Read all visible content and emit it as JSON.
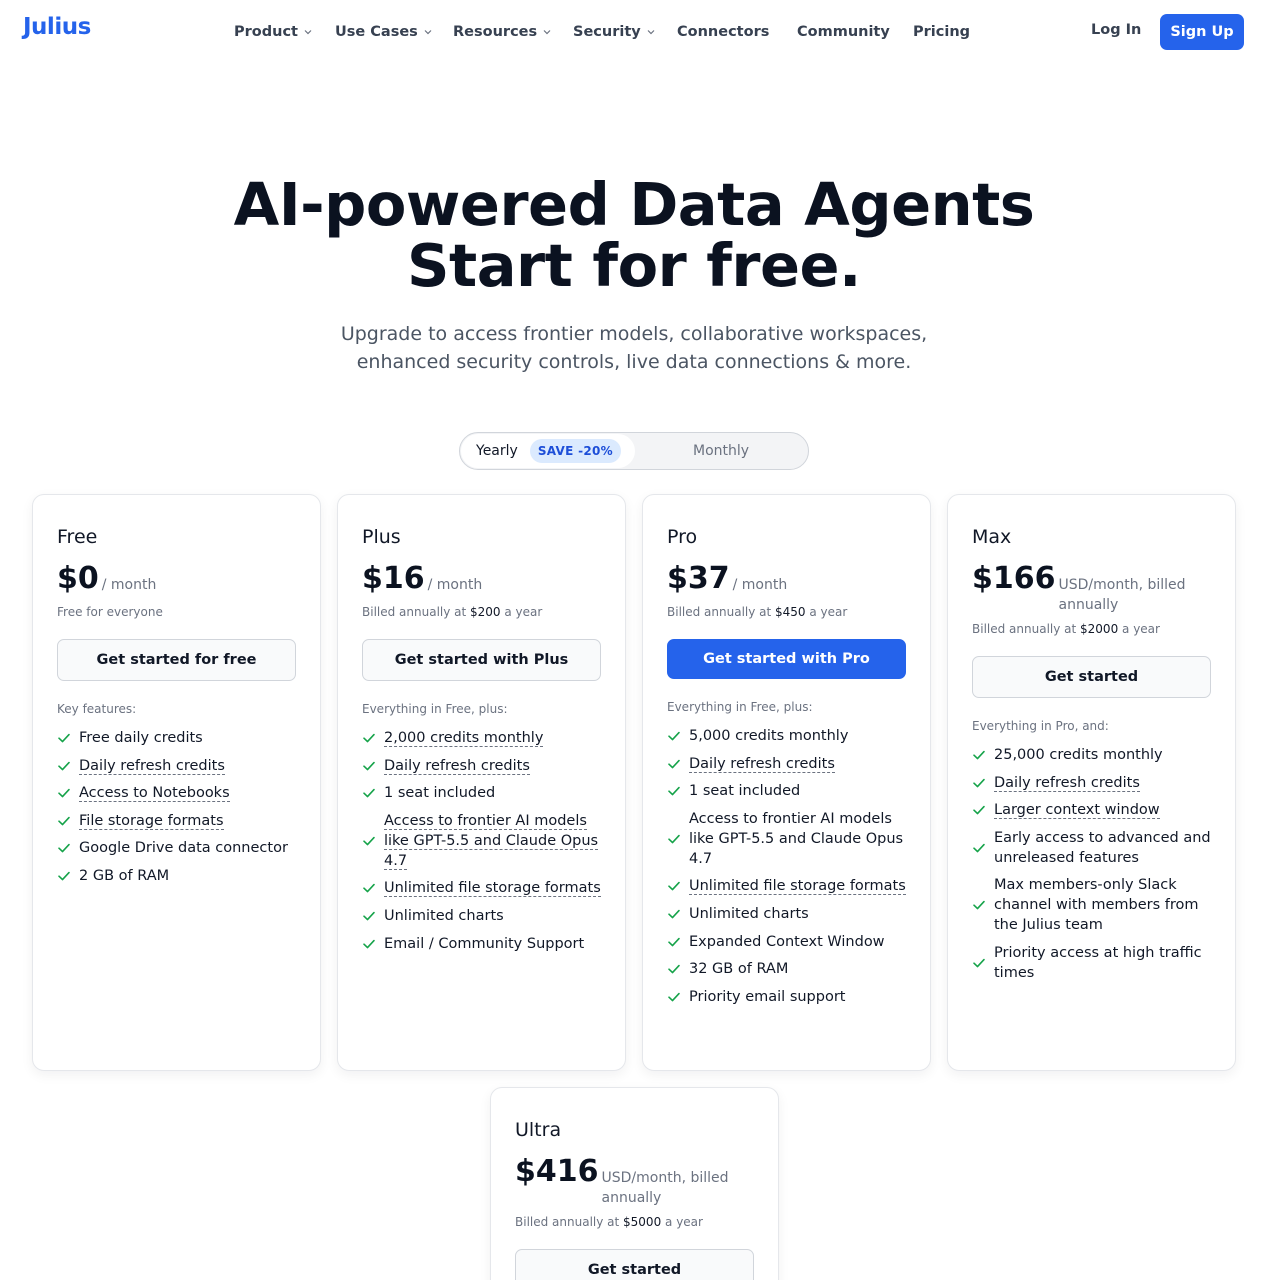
{
  "brand": {
    "logo": "Julius",
    "accent": "#2563eb"
  },
  "nav": {
    "items": [
      {
        "label": "Product",
        "dropdown": true
      },
      {
        "label": "Use Cases",
        "dropdown": true
      },
      {
        "label": "Resources",
        "dropdown": true
      },
      {
        "label": "Security",
        "dropdown": true
      },
      {
        "label": "Connectors",
        "dropdown": false
      },
      {
        "label": "Community",
        "dropdown": false
      },
      {
        "label": "Pricing",
        "dropdown": false
      }
    ],
    "login": "Log In",
    "signup": "Sign Up"
  },
  "hero": {
    "title_line1": "AI-powered Data Agents",
    "title_line2": "Start for free.",
    "sub_line1": "Upgrade to access frontier models, collaborative workspaces,",
    "sub_line2": "enhanced security controls, live data connections & more."
  },
  "billing_toggle": {
    "yearly": "Yearly",
    "save_badge": "SAVE -20%",
    "monthly": "Monthly",
    "selected": "Yearly"
  },
  "plans": [
    {
      "name": "Free",
      "price": "$0",
      "period": "/ month",
      "billed_pre": "Free for everyone",
      "billed_amount": "",
      "billed_post": "",
      "cta": "Get started for free",
      "features_heading": "Key features:",
      "features": [
        {
          "text": "Free daily credits",
          "underline": false
        },
        {
          "text": "Daily refresh credits",
          "underline": true
        },
        {
          "text": "Access to Notebooks",
          "underline": true
        },
        {
          "text": "File storage formats",
          "underline": true
        },
        {
          "text": "Google Drive data connector",
          "underline": false
        },
        {
          "text": "2 GB of RAM",
          "underline": false
        }
      ]
    },
    {
      "name": "Plus",
      "price": "$16",
      "period": "/ month",
      "billed_pre": "Billed annually at ",
      "billed_amount": "$200",
      "billed_post": " a year",
      "cta": "Get started with Plus",
      "features_heading": "Everything in Free, plus:",
      "features": [
        {
          "text": "2,000 credits monthly",
          "underline": true
        },
        {
          "text": "Daily refresh credits",
          "underline": true
        },
        {
          "text": "1 seat included",
          "underline": false
        },
        {
          "text": "Access to frontier AI models like GPT-5.5 and Claude Opus 4.7",
          "underline": true
        },
        {
          "text": "Unlimited file storage formats",
          "underline": true
        },
        {
          "text": "Unlimited charts",
          "underline": false
        },
        {
          "text": "Email / Community Support",
          "underline": false
        }
      ]
    },
    {
      "name": "Pro",
      "price": "$37",
      "period": "/ month",
      "billed_pre": "Billed annually at ",
      "billed_amount": "$450",
      "billed_post": " a year",
      "cta": "Get started with Pro",
      "features_heading": "Everything in Free, plus:",
      "features": [
        {
          "text": "5,000 credits monthly",
          "underline": false
        },
        {
          "text": "Daily refresh credits",
          "underline": true
        },
        {
          "text": "1 seat included",
          "underline": false
        },
        {
          "text": "Access to frontier AI models like GPT-5.5 and Claude Opus 4.7",
          "underline": false
        },
        {
          "text": "Unlimited file storage formats",
          "underline": true
        },
        {
          "text": "Unlimited charts",
          "underline": false
        },
        {
          "text": "Expanded Context Window",
          "underline": false
        },
        {
          "text": "32 GB of RAM",
          "underline": false
        },
        {
          "text": "Priority email support",
          "underline": false
        }
      ]
    },
    {
      "name": "Max",
      "price": "$166",
      "period": "USD/month, billed annually",
      "billed_pre": "Billed annually at ",
      "billed_amount": "$2000",
      "billed_post": " a year",
      "cta": "Get started",
      "features_heading": "Everything in Pro, and:",
      "features": [
        {
          "text": "25,000 credits monthly",
          "underline": false
        },
        {
          "text": "Daily refresh credits",
          "underline": true
        },
        {
          "text": "Larger context window",
          "underline": true
        },
        {
          "text": "Early access to advanced and unreleased features",
          "underline": false
        },
        {
          "text": "Max members-only Slack channel with members from the Julius team",
          "underline": false
        },
        {
          "text": "Priority access at high traffic times",
          "underline": false
        }
      ]
    },
    {
      "name": "Ultra",
      "price": "$416",
      "period": "USD/month, billed annually",
      "billed_pre": "Billed annually at ",
      "billed_amount": "$5000",
      "billed_post": " a year",
      "cta": "Get started",
      "features_heading": "",
      "features": []
    }
  ]
}
